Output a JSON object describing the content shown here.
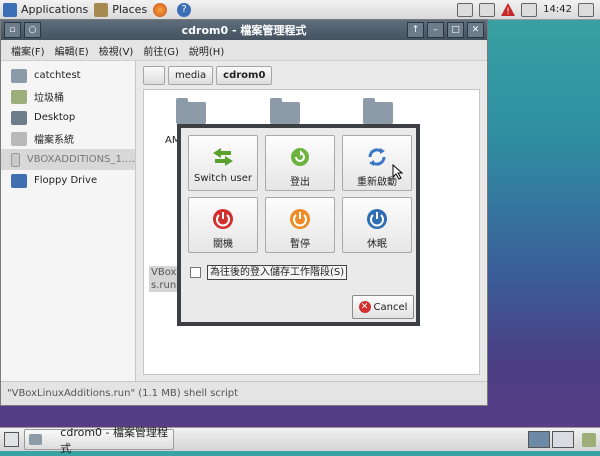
{
  "top_panel": {
    "applications_label": "Applications",
    "places_label": "Places",
    "clock": "14:42"
  },
  "window": {
    "title": "cdrom0 - 檔案管理程式",
    "menu": [
      "檔案(F)",
      "編輯(E)",
      "檢視(V)",
      "前往(G)",
      "說明(H)"
    ],
    "sidebar": [
      {
        "label": "catchtest",
        "icon": "home-folder-icon"
      },
      {
        "label": "垃圾桶",
        "icon": "trash-icon"
      },
      {
        "label": "Desktop",
        "icon": "desktop-icon"
      },
      {
        "label": "檔案系統",
        "icon": "drive-icon"
      },
      {
        "label": "VBOXADDITIONS_1.…",
        "icon": "optical-drive-icon"
      },
      {
        "label": "Floppy Drive",
        "icon": "floppy-icon"
      }
    ],
    "path": [
      "media",
      "cdrom0"
    ],
    "file_partial_label_top": "AM",
    "file_partial_label_bottom_1": "VBoxL",
    "file_partial_label_bottom_2": "s.run",
    "status": "\"VBoxLinuxAdditions.run\" (1.1 MB) shell script"
  },
  "dialog": {
    "actions": [
      {
        "label": "Switch user",
        "icon": "switch-user-icon"
      },
      {
        "label": "登出",
        "icon": "logout-icon"
      },
      {
        "label": "重新啟動",
        "icon": "restart-icon"
      },
      {
        "label": "關機",
        "icon": "shutdown-icon"
      },
      {
        "label": "暫停",
        "icon": "suspend-icon"
      },
      {
        "label": "休眠",
        "icon": "hibernate-icon"
      }
    ],
    "save_session_label": "為往後的登入儲存工作階段(S)",
    "cancel_label": "Cancel"
  },
  "taskbar": {
    "task_label": "cdrom0 - 檔案管理程式"
  }
}
